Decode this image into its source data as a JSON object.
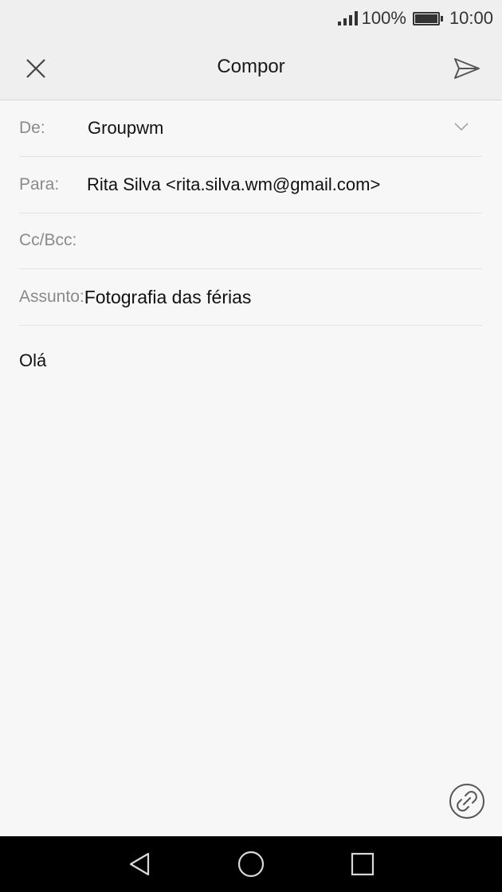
{
  "status_bar": {
    "battery_percent": "100%",
    "time": "10:00"
  },
  "toolbar": {
    "title": "Compor",
    "close_icon": "close-icon",
    "send_icon": "send-icon"
  },
  "form": {
    "from": {
      "label": "De:",
      "value": "Groupwm"
    },
    "to": {
      "label": "Para:",
      "value": "Rita Silva <rita.silva.wm@gmail.com>"
    },
    "cc": {
      "label": "Cc/Bcc:",
      "value": ""
    },
    "subject": {
      "label": "Assunto:",
      "value": "Fotografia das férias"
    }
  },
  "body": {
    "text": "Olá"
  },
  "attach_icon": "paperclip-icon",
  "nav_bar": {
    "back_icon": "back-icon",
    "home_icon": "home-icon",
    "recent_icon": "recent-apps-icon"
  },
  "colors": {
    "toolbar_bg": "#efefef",
    "page_bg": "#f7f7f7",
    "label": "#8a8a8a",
    "nav_bg": "#000000"
  }
}
